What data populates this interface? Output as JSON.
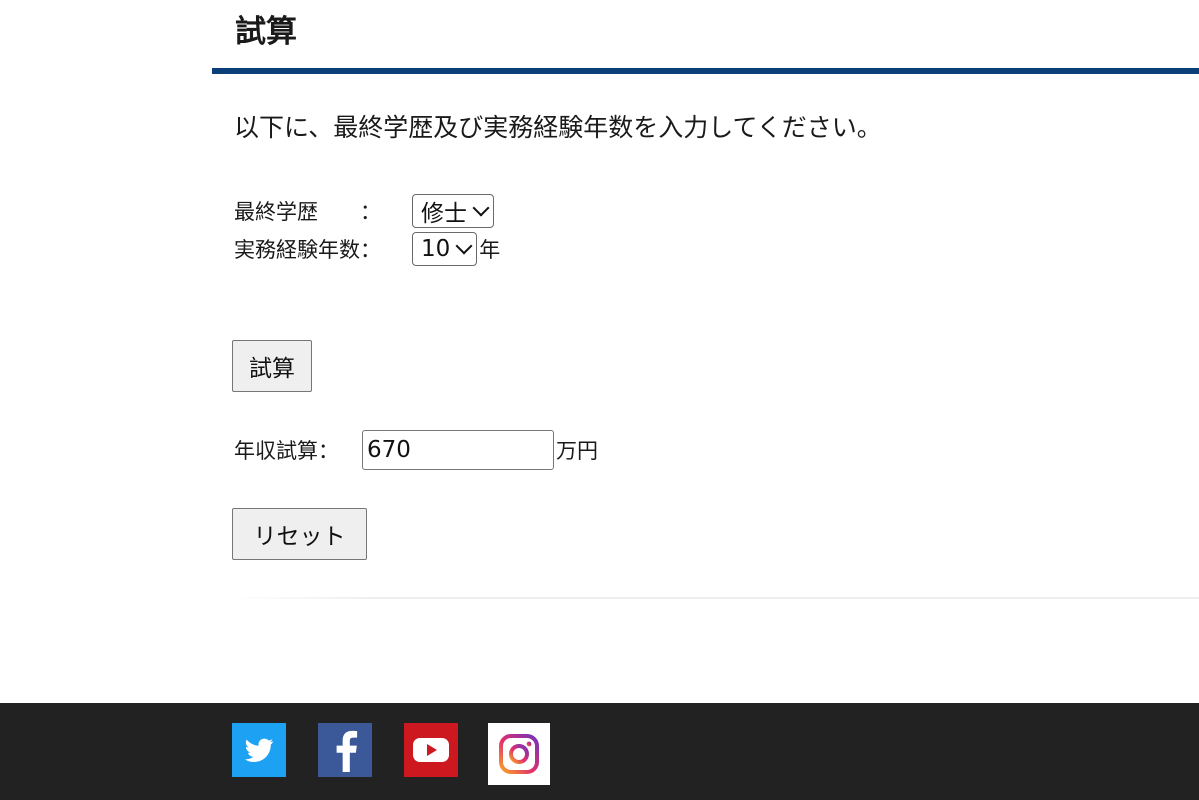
{
  "page": {
    "heading": "試算",
    "instruction": "以下に、最終学歴及び実務経験年数を入力してください。"
  },
  "form": {
    "education": {
      "label": "最終学歴　　：",
      "selected": "修士"
    },
    "experience": {
      "label": "実務経験年数：",
      "selected": "10",
      "unit": "年"
    },
    "calculate_label": "試算",
    "result": {
      "label": "年収試算：",
      "value": "670",
      "unit": "万円"
    },
    "reset_label": "リセット"
  },
  "footer": {
    "social": [
      {
        "icon": "twitter-icon",
        "color": "#1da1f2"
      },
      {
        "icon": "facebook-icon",
        "color": "#3b5998"
      },
      {
        "icon": "youtube-icon",
        "color": "#cc181e"
      },
      {
        "icon": "instagram-icon",
        "color": "#ffffff"
      }
    ]
  },
  "colors": {
    "accent_rule": "#0b3f78",
    "footer_bg": "#222222",
    "button_bg": "#efefef"
  }
}
